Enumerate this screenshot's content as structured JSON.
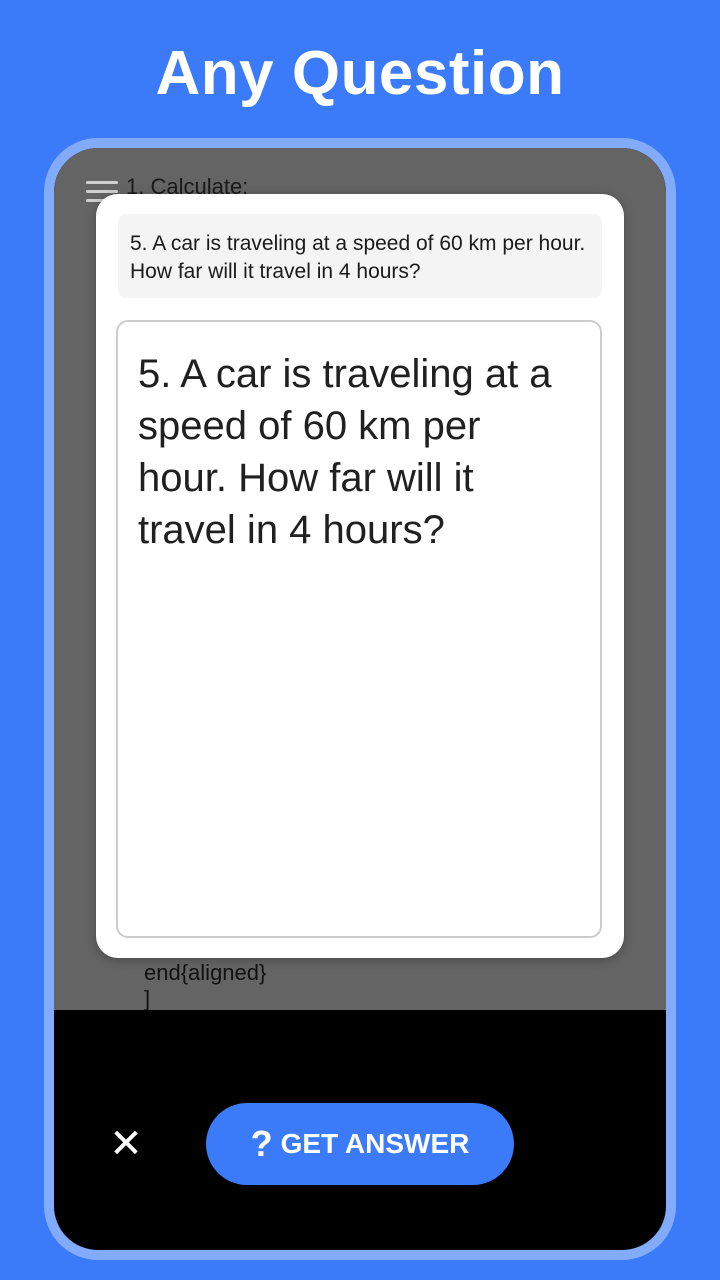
{
  "headline": "Any Question",
  "document": {
    "top_line": "1. Calculate:",
    "end_line": "end{aligned}",
    "bracket_line": "]"
  },
  "dialog": {
    "preview_text": "5. A car is traveling at a speed of 60 km per hour. How far will it travel in 4 hours?",
    "edit_text": "5. A car is traveling at a speed of 60 km per hour. How far will it travel in 4 hours?"
  },
  "actions": {
    "close_symbol": "✕",
    "answer_icon": "?",
    "answer_label": "GET ANSWER"
  },
  "colors": {
    "background": "#3b7bfa",
    "frame": "#82abfb",
    "accent_button": "#3b7bfa"
  }
}
